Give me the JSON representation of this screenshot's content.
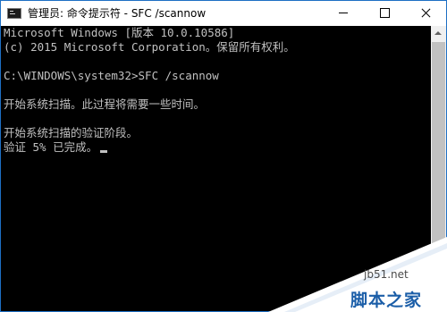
{
  "window": {
    "title": "管理员: 命令提示符 - SFC  /scannow"
  },
  "console": {
    "lines": [
      "Microsoft Windows [版本 10.0.10586]",
      "(c) 2015 Microsoft Corporation。保留所有权利。",
      "C:\\WINDOWS\\system32>SFC /scannow",
      "开始系统扫描。此过程将需要一些时间。",
      "开始系统扫描的验证阶段。",
      "验证 5% 已完成。"
    ]
  },
  "watermark": {
    "site": "jb51.net",
    "name": "脚本之家"
  },
  "colors": {
    "console_bg": "#000000",
    "console_text": "#c0c0c0",
    "titlebar_bg": "#ffffff",
    "window_border": "#1e6fc4",
    "watermark_blue": "#1b5ea8"
  },
  "icons": [
    "cmd-app-icon",
    "minimize-icon",
    "maximize-icon",
    "close-icon",
    "scroll-up-arrow-icon"
  ]
}
